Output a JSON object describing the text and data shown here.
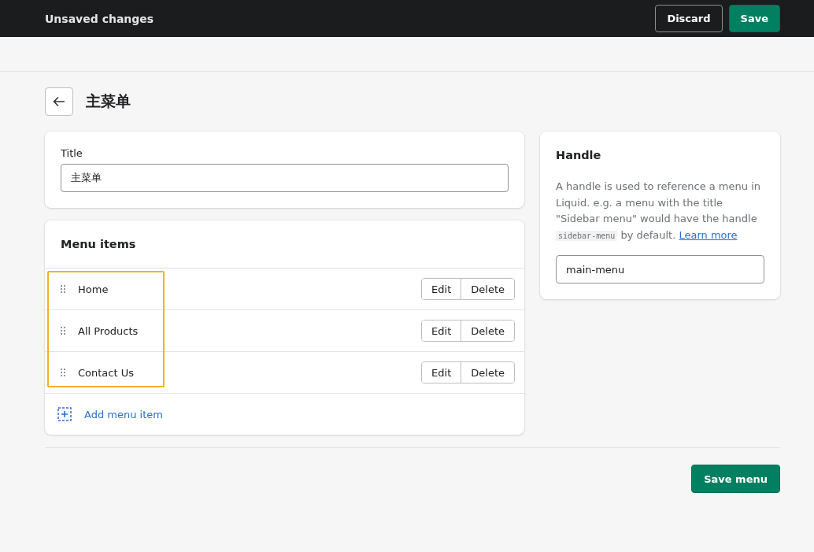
{
  "top_bar": {
    "title": "Unsaved changes",
    "buttons": [
      {
        "label": "Discard",
        "kind": "secondary"
      },
      {
        "label": "Save",
        "kind": "primary"
      }
    ]
  },
  "page": {
    "title": "主菜单"
  },
  "title_card": {
    "label": "Title",
    "value": "主菜单"
  },
  "menu_items": {
    "heading": "Menu items",
    "items": [
      {
        "label": "Home",
        "actions": [
          "Edit",
          "Delete"
        ]
      },
      {
        "label": "All Products",
        "actions": [
          "Edit",
          "Delete"
        ]
      },
      {
        "label": "Contact Us",
        "actions": [
          "Edit",
          "Delete"
        ]
      }
    ],
    "add_link": "Add menu item"
  },
  "handle_card": {
    "heading": "Handle",
    "description": [
      {
        "kind": "text",
        "text": "A handle is used to reference a menu in Liquid. e.g. a menu with the title \"Sidebar menu\" would have the handle "
      },
      {
        "kind": "code",
        "text": "sidebar-menu"
      },
      {
        "kind": "text",
        "text": " by default. "
      },
      {
        "kind": "link",
        "text": "Learn more"
      }
    ],
    "value": "main-menu"
  },
  "footer": {
    "button": "Save menu"
  }
}
